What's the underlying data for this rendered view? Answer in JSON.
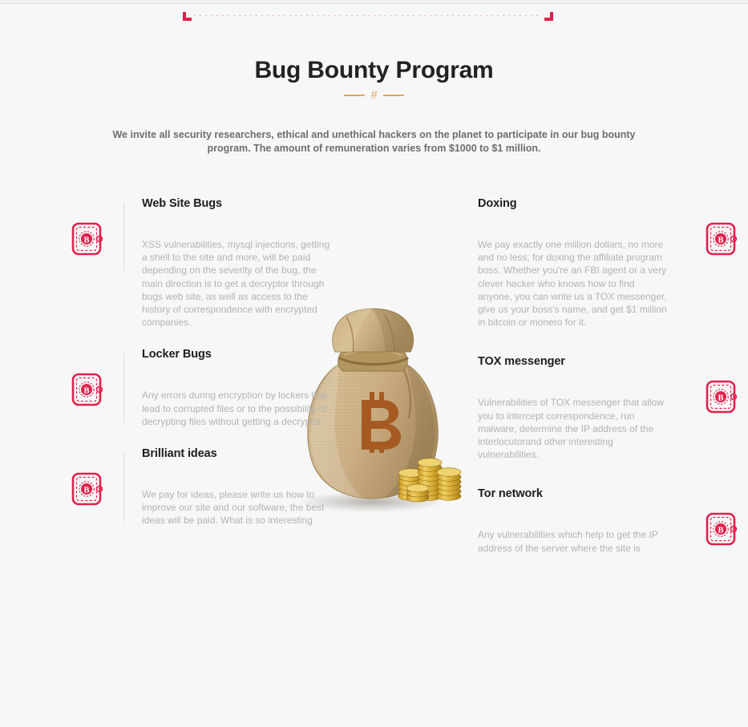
{
  "page": {
    "title": "Bug Bounty Program",
    "divider_symbol": "#",
    "intro": "We invite all security researchers, ethical and unethical hackers on the planet to participate in our bug bounty program. The amount of remuneration varies from $1000 to $1 million."
  },
  "colors": {
    "background": "#f7f7f7",
    "title": "#222222",
    "accent_orange": "#e0a85c",
    "accent_red": "#e0224b",
    "body_text": "#b3b3b3",
    "intro_text": "#6d6d6d",
    "divider_gray": "#dcdcdc",
    "bag_burlap": "#c9ad7f",
    "coin_gold": "#d4a32a"
  },
  "illustration": {
    "name": "bitcoin-money-bag",
    "symbol": "₿",
    "alt": "Burlap money bag with bitcoin logo and stacks of gold coins"
  },
  "left_column": [
    {
      "icon": "bitcoin-wallet-icon",
      "title": "Web Site Bugs",
      "body": "XSS vulnerabilities, mysql injections, getting a shell to the site and more, will be paid depending on the severity of the bug, the main direction is to get a decryptor through bugs web site, as well as access to the history of correspondence with encrypted companies."
    },
    {
      "icon": "bitcoin-wallet-icon",
      "title": "Locker Bugs",
      "body": "Any errors during encryption by lockers that lead to corrupted files or to the possibility of decrypting files without getting a decryptor."
    },
    {
      "icon": "bitcoin-wallet-icon",
      "title": "Brilliant ideas",
      "body": "We pay for ideas, please write us how to improve our site and our software, the best ideas will be paid. What is so interesting"
    }
  ],
  "right_column": [
    {
      "icon": "bitcoin-wallet-icon",
      "title": "Doxing",
      "body": "We pay exactly one million dollars, no more and no less, for doxing the affiliate program boss. Whether you're an FBI agent or a very clever hacker who knows how to find anyone, you can write us a TOX messenger, give us your boss's name, and get $1 million in bitcoin or monero for it."
    },
    {
      "icon": "bitcoin-wallet-icon",
      "title": "TOX messenger",
      "body": "Vulnerabilities of TOX messenger that allow you to intercept correspondence, run malware, determine the IP address of the interlocutorand other interesting vulnerabilities."
    },
    {
      "icon": "bitcoin-wallet-icon",
      "title": "Tor network",
      "body": "Any vulnerabilities which help to get the IP address of the server where the site is"
    }
  ]
}
